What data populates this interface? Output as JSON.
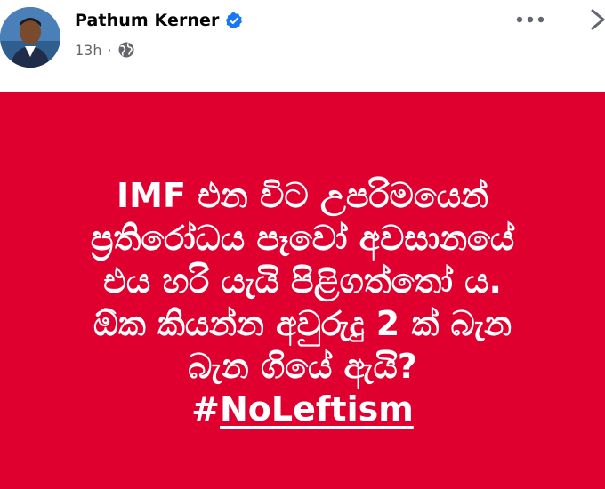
{
  "post": {
    "author_name": "Pathum Kerner",
    "verified": true,
    "time_ago": "13h",
    "separator": "·",
    "privacy": "globe-icon"
  },
  "text_lines": [
    "IMF එන විට උපරිමයෙන්",
    "ප්‍රතිරෝධය පෑවෝ අවසානයේ",
    "එය හරි යැයි පිළිගත්තෝ ය.",
    "ඕක කියන්න අවුරුදු 2 ක් බැන",
    "බැන ගියේ ඇයි?"
  ],
  "hashtag_prefix": "#",
  "hashtag_text": "NoLeftism",
  "colors": {
    "card_background": "#e0002f",
    "verified_badge": "#1877f2",
    "meta_text": "#65676b"
  }
}
